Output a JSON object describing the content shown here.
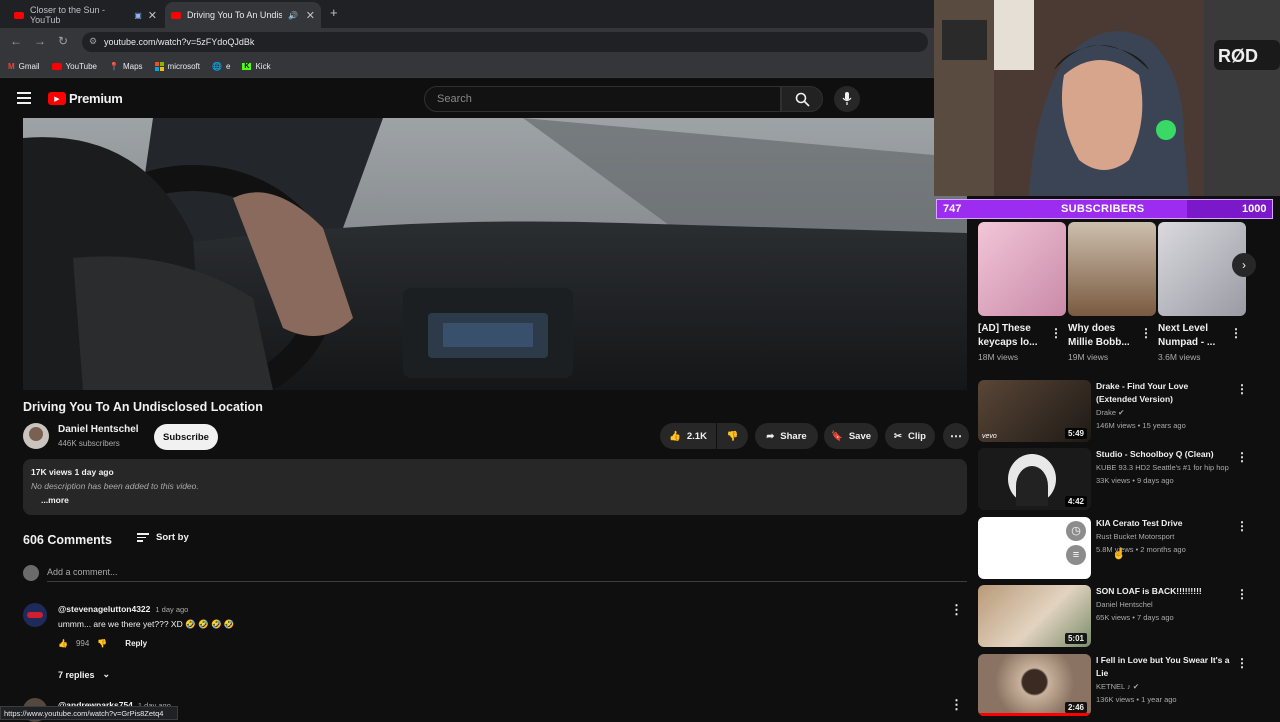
{
  "tabs": [
    {
      "label": "Closer to the Sun - YouTub",
      "active": false
    },
    {
      "label": "Driving You To An Undiscl",
      "active": true
    }
  ],
  "new_tab": "+",
  "url": "youtube.com/watch?v=5zFYdoQJdBk",
  "bookmarks": [
    "Gmail",
    "YouTube",
    "Maps",
    "microsoft",
    "e",
    "Kick"
  ],
  "yt": {
    "brand": "Premium",
    "search_placeholder": "Search"
  },
  "video": {
    "title": "Driving You To An Undisclosed Location",
    "channel": "Daniel Hentschel",
    "subscribers": "446K subscribers",
    "subscribe_label": "Subscribe",
    "likes": "2.1K",
    "share_label": "Share",
    "save_label": "Save",
    "clip_label": "Clip",
    "views_date": "17K views  1 day ago",
    "description": "No description has been added to this video.",
    "more_label": "...more"
  },
  "comments": {
    "count": "606 Comments",
    "sort_label": "Sort by",
    "add_placeholder": "Add a comment...",
    "items": [
      {
        "author": "@stevenagelutton4322",
        "time": "1 day ago",
        "text": "ummm... are we there yet??? XD 🤣 🤣 🤣 🤣",
        "likes": "994",
        "reply_label": "Reply",
        "replies": "7 replies"
      },
      {
        "author": "@andrewparks754",
        "time": "1 day ago"
      }
    ]
  },
  "status_url": "https://www.youtube.com/watch?v=GrPis8Zetq4",
  "stream": {
    "sub_current": "747",
    "sub_label": "SUBSCRIBERS",
    "sub_goal": "1000",
    "sub_progress": 0.747
  },
  "shorts": [
    {
      "title": "[AD] These keycaps lo...",
      "views": "18M views"
    },
    {
      "title": "Why does Millie Bobb...",
      "views": "19M views"
    },
    {
      "title": "Next Level Numpad - ...",
      "views": "3.6M views"
    }
  ],
  "related": [
    {
      "title": "Drake - Find Your Love (Extended Version)",
      "channel": "Drake",
      "meta": "146M views • 15 years ago",
      "duration": "5:49"
    },
    {
      "title": "Studio - Schoolboy Q (Clean)",
      "channel": "KUBE 93.3 HD2 Seattle's #1 for hip hop",
      "meta": "33K views • 9 days ago",
      "duration": "4:42"
    },
    {
      "title": "KIA Cerato Test Drive",
      "channel": "Rust Bucket Motorsport",
      "meta": "5.8M views • 2 months ago",
      "duration": ""
    },
    {
      "title": "SON LOAF is BACK!!!!!!!!!",
      "channel": "Daniel Hentschel",
      "meta": "65K views • 7 days ago",
      "duration": "5:01"
    },
    {
      "title": "I Fell in Love but You Swear It's a Lie",
      "channel": "KETNEL",
      "meta": "136K views • 1 year ago",
      "duration": "2:46"
    }
  ]
}
